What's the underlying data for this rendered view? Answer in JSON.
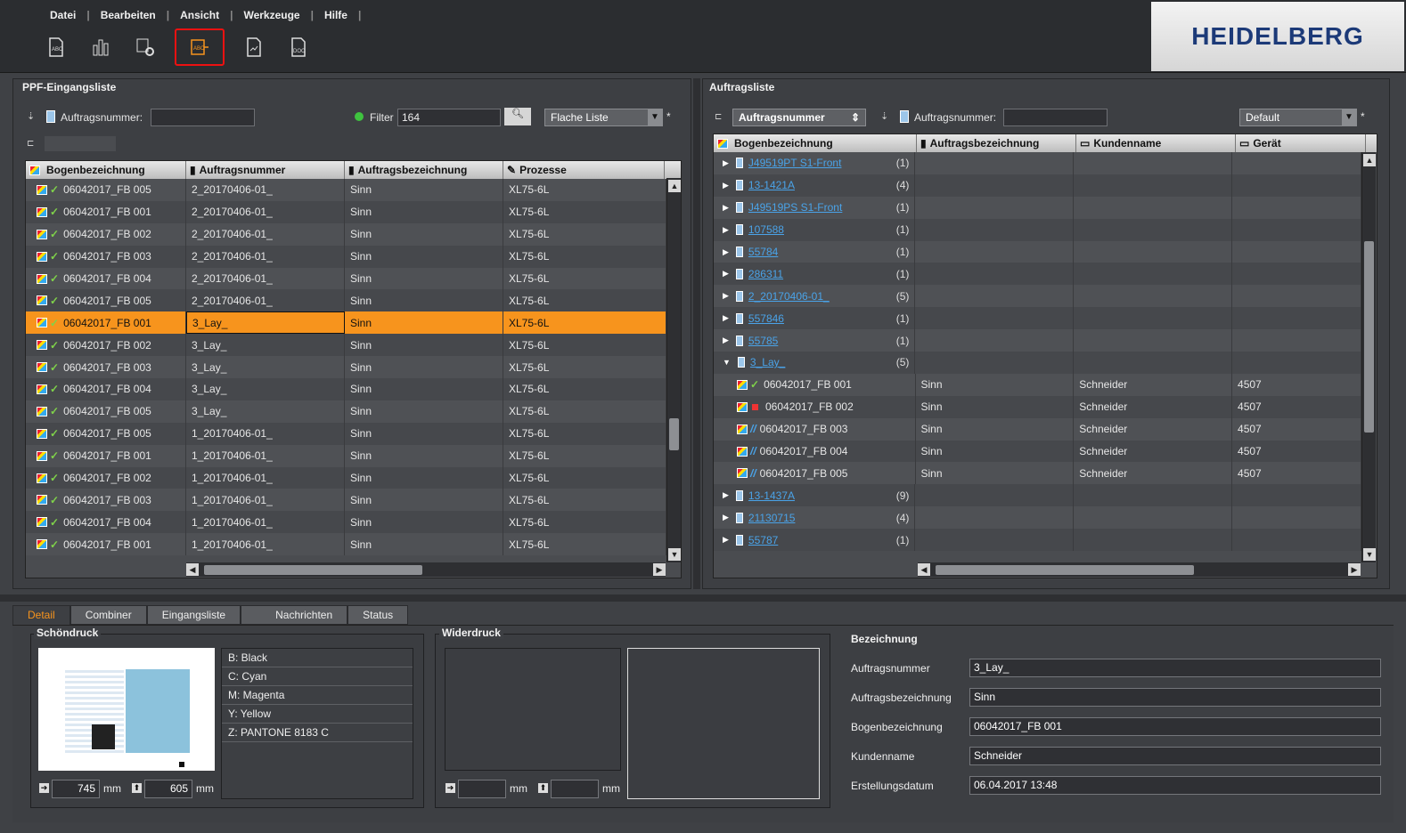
{
  "menu": [
    "Datei",
    "Bearbeiten",
    "Ansicht",
    "Werkzeuge",
    "Hilfe"
  ],
  "logo": "HEIDELBERG",
  "toolbar": [
    {
      "icon": "abc-document-icon"
    },
    {
      "icon": "chart-document-icon"
    },
    {
      "icon": "device-settings-icon"
    },
    {
      "icon": "abc-combine-icon",
      "active": true
    },
    {
      "icon": "signed-document-icon"
    },
    {
      "icon": "doc-file-icon"
    }
  ],
  "left": {
    "title": "PPF-Eingangsliste",
    "order_label": "Auftragsnummer:",
    "order_value": "",
    "filter_label": "Filter",
    "filter_value": "164",
    "view_select": "Flache Liste",
    "asterisk": "*",
    "columns": [
      "Bogenbezeichnung",
      "Auftragsnummer",
      "Auftragsbezeichnung",
      "Prozesse"
    ],
    "rows": [
      [
        "06042017_FB 005",
        "2_20170406-01_",
        "Sinn",
        "XL75-6L"
      ],
      [
        "06042017_FB 001",
        "2_20170406-01_",
        "Sinn",
        "XL75-6L"
      ],
      [
        "06042017_FB 002",
        "2_20170406-01_",
        "Sinn",
        "XL75-6L"
      ],
      [
        "06042017_FB 003",
        "2_20170406-01_",
        "Sinn",
        "XL75-6L"
      ],
      [
        "06042017_FB 004",
        "2_20170406-01_",
        "Sinn",
        "XL75-6L"
      ],
      [
        "06042017_FB 005",
        "2_20170406-01_",
        "Sinn",
        "XL75-6L"
      ],
      [
        "06042017_FB 001",
        "3_Lay_",
        "Sinn",
        "XL75-6L"
      ],
      [
        "06042017_FB 002",
        "3_Lay_",
        "Sinn",
        "XL75-6L"
      ],
      [
        "06042017_FB 003",
        "3_Lay_",
        "Sinn",
        "XL75-6L"
      ],
      [
        "06042017_FB 004",
        "3_Lay_",
        "Sinn",
        "XL75-6L"
      ],
      [
        "06042017_FB 005",
        "3_Lay_",
        "Sinn",
        "XL75-6L"
      ],
      [
        "06042017_FB 005",
        "1_20170406-01_",
        "Sinn",
        "XL75-6L"
      ],
      [
        "06042017_FB 001",
        "1_20170406-01_",
        "Sinn",
        "XL75-6L"
      ],
      [
        "06042017_FB 002",
        "1_20170406-01_",
        "Sinn",
        "XL75-6L"
      ],
      [
        "06042017_FB 003",
        "1_20170406-01_",
        "Sinn",
        "XL75-6L"
      ],
      [
        "06042017_FB 004",
        "1_20170406-01_",
        "Sinn",
        "XL75-6L"
      ],
      [
        "06042017_FB 001",
        "1_20170406-01_",
        "Sinn",
        "XL75-6L"
      ]
    ]
  },
  "right": {
    "title": "Auftragsliste",
    "group_select": "Auftragsnummer",
    "order_label": "Auftragsnummer:",
    "order_value": "",
    "view_select": "Default",
    "asterisk": "*",
    "columns": [
      "Bogenbezeichnung",
      "Auftragsbezeichnung",
      "Kundenname",
      "Gerät"
    ],
    "rows": [
      {
        "type": "group",
        "name": "J49519PT S1-Front",
        "count": "(1)"
      },
      {
        "type": "group",
        "name": "13-1421A",
        "count": "(4)"
      },
      {
        "type": "group",
        "name": "J49519PS S1-Front",
        "count": "(1)"
      },
      {
        "type": "group",
        "name": "107588",
        "count": "(1)"
      },
      {
        "type": "group",
        "name": "55784",
        "count": "(1)"
      },
      {
        "type": "group",
        "name": "286311",
        "count": "(1)"
      },
      {
        "type": "group",
        "name": "2_20170406-01_",
        "count": "(5)"
      },
      {
        "type": "group",
        "name": "557846",
        "count": "(1)"
      },
      {
        "type": "group",
        "name": "55785",
        "count": "(1)"
      },
      {
        "type": "group",
        "name": "3_Lay_",
        "count": "(5)",
        "open": true
      },
      {
        "type": "child",
        "status": "check",
        "name": "06042017_FB 001",
        "desc": "Sinn",
        "customer": "Schneider",
        "device": "4507"
      },
      {
        "type": "child",
        "status": "stop",
        "name": "06042017_FB 002",
        "desc": "Sinn",
        "customer": "Schneider",
        "device": "4507"
      },
      {
        "type": "child",
        "status": "run",
        "name": "06042017_FB 003",
        "desc": "Sinn",
        "customer": "Schneider",
        "device": "4507"
      },
      {
        "type": "child",
        "status": "run",
        "name": "06042017_FB 004",
        "desc": "Sinn",
        "customer": "Schneider",
        "device": "4507"
      },
      {
        "type": "child",
        "status": "run",
        "name": "06042017_FB 005",
        "desc": "Sinn",
        "customer": "Schneider",
        "device": "4507"
      },
      {
        "type": "group",
        "name": "13-1437A",
        "count": "(9)"
      },
      {
        "type": "group",
        "name": "21130715",
        "count": "(4)"
      },
      {
        "type": "group",
        "name": "55787",
        "count": "(1)"
      }
    ]
  },
  "tabs": [
    "Detail",
    "Combiner",
    "Eingangsliste",
    "Nachrichten",
    "Status"
  ],
  "schondruck": {
    "title": "Schöndruck",
    "separations": [
      "B: Black",
      "C: Cyan",
      "M: Magenta",
      "Y: Yellow",
      "Z: PANTONE 8183 C"
    ],
    "width": "745",
    "height": "605",
    "unit": "mm"
  },
  "widerdruck": {
    "title": "Widerdruck",
    "width": "",
    "height": "",
    "unit": "mm"
  },
  "bezeichnung": {
    "title": "Bezeichnung",
    "fields": [
      {
        "label": "Auftragsnummer",
        "value": "3_Lay_"
      },
      {
        "label": "Auftragsbezeichnung",
        "value": "Sinn"
      },
      {
        "label": "Bogenbezeichnung",
        "value": "06042017_FB 001"
      },
      {
        "label": "Kundenname",
        "value": "Schneider"
      },
      {
        "label": "Erstellungsdatum",
        "value": "06.04.2017 13:48"
      }
    ]
  }
}
